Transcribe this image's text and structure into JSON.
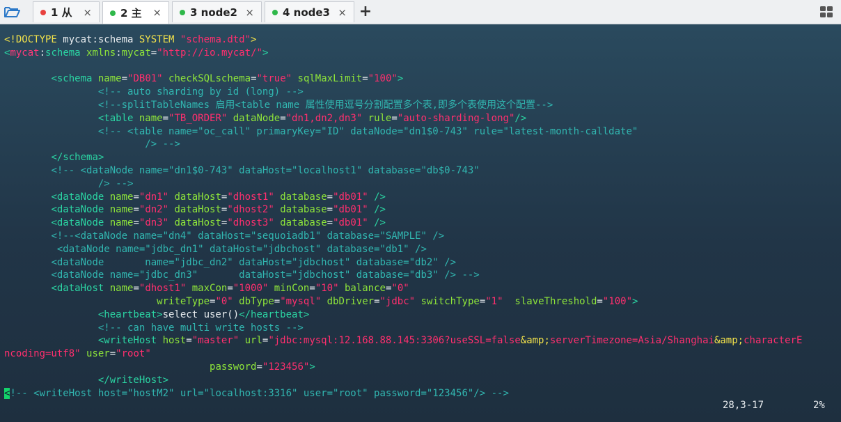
{
  "tabs": [
    {
      "label": "1 从",
      "dot_color": "#e8423f"
    },
    {
      "label": "2 主",
      "dot_color": "#2fb84a"
    },
    {
      "label": "3 node2",
      "dot_color": "#2fb84a"
    },
    {
      "label": "4 node3",
      "dot_color": "#2fb84a"
    }
  ],
  "active_tab": 1,
  "close_glyph": "×",
  "new_tab_glyph": "+",
  "icons": {
    "open": "folder-open-icon",
    "layout": "grid-layout-icon"
  },
  "editor": {
    "lines": [
      [
        [
          "y",
          "<!DOCTYPE "
        ],
        [
          "w",
          "mycat:schema "
        ],
        [
          "y",
          "SYSTEM "
        ],
        [
          "s",
          "\"schema.dtd\""
        ],
        [
          "y",
          ">"
        ]
      ],
      [
        [
          "t",
          "<"
        ],
        [
          "r",
          "mycat"
        ],
        [
          "w",
          ":"
        ],
        [
          "t",
          "schema "
        ],
        [
          "k",
          "xmlns"
        ],
        [
          "w",
          ":"
        ],
        [
          "k",
          "mycat"
        ],
        [
          "w",
          "="
        ],
        [
          "s",
          "\"http://io.mycat/\""
        ],
        [
          "t",
          ">"
        ]
      ],
      [
        [
          "w",
          ""
        ]
      ],
      [
        [
          "w",
          "        "
        ],
        [
          "t",
          "<schema "
        ],
        [
          "k",
          "name"
        ],
        [
          "w",
          "="
        ],
        [
          "s",
          "\"DB01\" "
        ],
        [
          "k",
          "checkSQLschema"
        ],
        [
          "w",
          "="
        ],
        [
          "s",
          "\"true\" "
        ],
        [
          "k",
          "sqlMaxLimit"
        ],
        [
          "w",
          "="
        ],
        [
          "s",
          "\"100\""
        ],
        [
          "t",
          ">"
        ]
      ],
      [
        [
          "w",
          "                "
        ],
        [
          "c",
          "<!-- auto sharding by id (long) -->"
        ]
      ],
      [
        [
          "w",
          "                "
        ],
        [
          "c",
          "<!--splitTableNames 启用<table name 属性使用逗号分割配置多个表,即多个表使用这个配置-->"
        ]
      ],
      [
        [
          "w",
          "                "
        ],
        [
          "t",
          "<table "
        ],
        [
          "k",
          "name"
        ],
        [
          "w",
          "="
        ],
        [
          "s",
          "\"TB_ORDER\" "
        ],
        [
          "k",
          "dataNode"
        ],
        [
          "w",
          "="
        ],
        [
          "s",
          "\"dn1,dn2,dn3\" "
        ],
        [
          "k",
          "rule"
        ],
        [
          "w",
          "="
        ],
        [
          "s",
          "\"auto-sharding-long\""
        ],
        [
          "t",
          "/>"
        ]
      ],
      [
        [
          "w",
          "                "
        ],
        [
          "c",
          "<!-- <table name=\"oc_call\" primaryKey=\"ID\" dataNode=\"dn1$0-743\" rule=\"latest-month-calldate\""
        ]
      ],
      [
        [
          "w",
          "                        "
        ],
        [
          "c",
          "/> -->"
        ]
      ],
      [
        [
          "w",
          "        "
        ],
        [
          "t",
          "</schema>"
        ]
      ],
      [
        [
          "w",
          "        "
        ],
        [
          "c",
          "<!-- <dataNode name=\"dn1$0-743\" dataHost=\"localhost1\" database=\"db$0-743\""
        ]
      ],
      [
        [
          "w",
          "                "
        ],
        [
          "c",
          "/> -->"
        ]
      ],
      [
        [
          "w",
          "        "
        ],
        [
          "t",
          "<dataNode "
        ],
        [
          "k",
          "name"
        ],
        [
          "w",
          "="
        ],
        [
          "s",
          "\"dn1\" "
        ],
        [
          "k",
          "dataHost"
        ],
        [
          "w",
          "="
        ],
        [
          "s",
          "\"dhost1\" "
        ],
        [
          "k",
          "database"
        ],
        [
          "w",
          "="
        ],
        [
          "s",
          "\"db01\" "
        ],
        [
          "t",
          "/>"
        ]
      ],
      [
        [
          "w",
          "        "
        ],
        [
          "t",
          "<dataNode "
        ],
        [
          "k",
          "name"
        ],
        [
          "w",
          "="
        ],
        [
          "s",
          "\"dn2\" "
        ],
        [
          "k",
          "dataHost"
        ],
        [
          "w",
          "="
        ],
        [
          "s",
          "\"dhost2\" "
        ],
        [
          "k",
          "database"
        ],
        [
          "w",
          "="
        ],
        [
          "s",
          "\"db01\" "
        ],
        [
          "t",
          "/>"
        ]
      ],
      [
        [
          "w",
          "        "
        ],
        [
          "t",
          "<dataNode "
        ],
        [
          "k",
          "name"
        ],
        [
          "w",
          "="
        ],
        [
          "s",
          "\"dn3\" "
        ],
        [
          "k",
          "dataHost"
        ],
        [
          "w",
          "="
        ],
        [
          "s",
          "\"dhost3\" "
        ],
        [
          "k",
          "database"
        ],
        [
          "w",
          "="
        ],
        [
          "s",
          "\"db01\" "
        ],
        [
          "t",
          "/>"
        ]
      ],
      [
        [
          "w",
          "        "
        ],
        [
          "c",
          "<!--<dataNode name=\"dn4\" dataHost=\"sequoiadb1\" database=\"SAMPLE\" />"
        ]
      ],
      [
        [
          "w",
          "         "
        ],
        [
          "c",
          "<dataNode name=\"jdbc_dn1\" dataHost=\"jdbchost\" database=\"db1\" />"
        ]
      ],
      [
        [
          "w",
          "        "
        ],
        [
          "c",
          "<dataNode       name=\"jdbc_dn2\" dataHost=\"jdbchost\" database=\"db2\" />"
        ]
      ],
      [
        [
          "w",
          "        "
        ],
        [
          "c",
          "<dataNode name=\"jdbc_dn3\"       dataHost=\"jdbchost\" database=\"db3\" /> -->"
        ]
      ],
      [
        [
          "w",
          "        "
        ],
        [
          "t",
          "<dataHost "
        ],
        [
          "k",
          "name"
        ],
        [
          "w",
          "="
        ],
        [
          "s",
          "\"dhost1\" "
        ],
        [
          "k",
          "maxCon"
        ],
        [
          "w",
          "="
        ],
        [
          "s",
          "\"1000\" "
        ],
        [
          "k",
          "minCon"
        ],
        [
          "w",
          "="
        ],
        [
          "s",
          "\"10\" "
        ],
        [
          "k",
          "balance"
        ],
        [
          "w",
          "="
        ],
        [
          "s",
          "\"0\""
        ]
      ],
      [
        [
          "w",
          "                          "
        ],
        [
          "k",
          "writeType"
        ],
        [
          "w",
          "="
        ],
        [
          "s",
          "\"0\" "
        ],
        [
          "k",
          "dbType"
        ],
        [
          "w",
          "="
        ],
        [
          "s",
          "\"mysql\" "
        ],
        [
          "k",
          "dbDriver"
        ],
        [
          "w",
          "="
        ],
        [
          "s",
          "\"jdbc\" "
        ],
        [
          "k",
          "switchType"
        ],
        [
          "w",
          "="
        ],
        [
          "s",
          "\"1\"  "
        ],
        [
          "k",
          "slaveThreshold"
        ],
        [
          "w",
          "="
        ],
        [
          "s",
          "\"100\""
        ],
        [
          "t",
          ">"
        ]
      ],
      [
        [
          "w",
          "                "
        ],
        [
          "t",
          "<heartbeat>"
        ],
        [
          "w",
          "select user()"
        ],
        [
          "t",
          "</heartbeat>"
        ]
      ],
      [
        [
          "w",
          "                "
        ],
        [
          "c",
          "<!-- can have multi write hosts -->"
        ]
      ],
      [
        [
          "w",
          "                "
        ],
        [
          "t",
          "<writeHost "
        ],
        [
          "k",
          "host"
        ],
        [
          "w",
          "="
        ],
        [
          "s",
          "\"master\" "
        ],
        [
          "k",
          "url"
        ],
        [
          "w",
          "="
        ],
        [
          "s",
          "\"jdbc:mysql:12.168.88.145:3306?useSSL=false"
        ],
        [
          "y",
          "&amp;"
        ],
        [
          "s",
          "serverTimezone=Asia/Shanghai"
        ],
        [
          "y",
          "&amp;"
        ],
        [
          "s",
          "characterE"
        ]
      ],
      [
        [
          "s",
          "ncoding=utf8\" "
        ],
        [
          "k",
          "user"
        ],
        [
          "w",
          "="
        ],
        [
          "s",
          "\"root\""
        ]
      ],
      [
        [
          "w",
          "                                   "
        ],
        [
          "k",
          "password"
        ],
        [
          "w",
          "="
        ],
        [
          "s",
          "\"123456\""
        ],
        [
          "t",
          ">"
        ]
      ],
      [
        [
          "w",
          "                "
        ],
        [
          "t",
          "</writeHost>"
        ]
      ],
      [
        [
          "cur",
          "<"
        ],
        [
          "c",
          "!-- <writeHost host=\"hostM2\" url=\"localhost:3316\" user=\"root\" password=\"123456\"/> -->"
        ]
      ]
    ]
  },
  "status": {
    "position": "28,3-17",
    "percent": "2%"
  }
}
